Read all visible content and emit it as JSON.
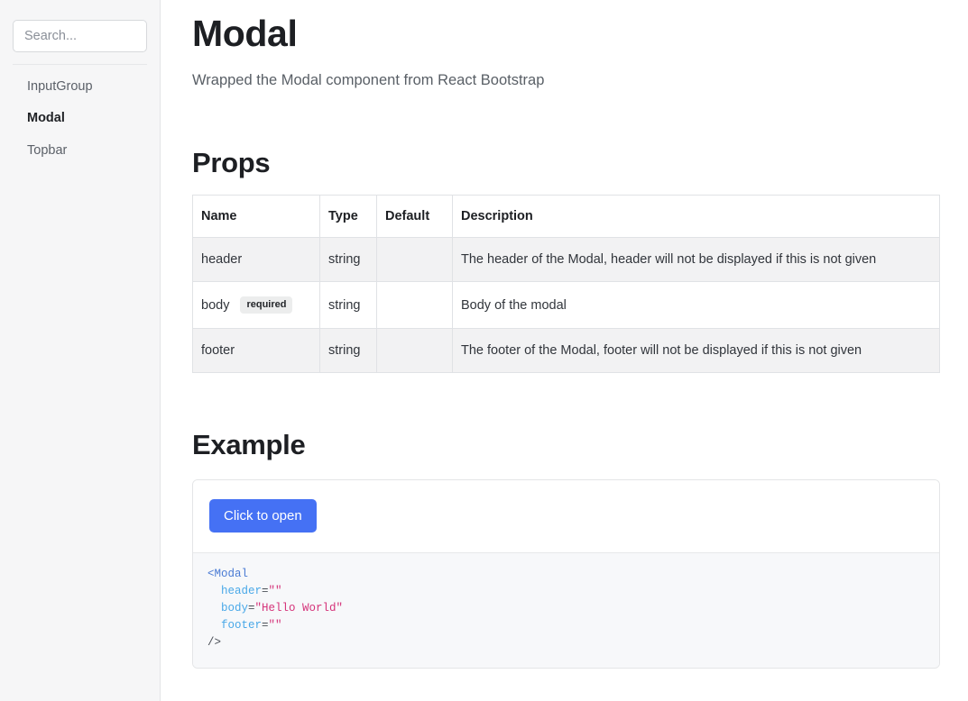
{
  "sidebar": {
    "search": {
      "placeholder": "Search...",
      "value": ""
    },
    "items": [
      {
        "label": "InputGroup",
        "active": false
      },
      {
        "label": "Modal",
        "active": true
      },
      {
        "label": "Topbar",
        "active": false
      }
    ]
  },
  "main": {
    "title": "Modal",
    "subtitle": "Wrapped the Modal component from React Bootstrap",
    "props_section": {
      "heading": "Props",
      "columns": [
        "Name",
        "Type",
        "Default",
        "Description"
      ],
      "rows": [
        {
          "name": "header",
          "required": false,
          "required_label": "",
          "type": "string",
          "default": "",
          "description": "The header of the Modal, header will not be displayed if this is not given"
        },
        {
          "name": "body",
          "required": true,
          "required_label": "required",
          "type": "string",
          "default": "",
          "description": "Body of the modal"
        },
        {
          "name": "footer",
          "required": false,
          "required_label": "",
          "type": "string",
          "default": "",
          "description": "The footer of the Modal, footer will not be displayed if this is not given"
        }
      ]
    },
    "example_section": {
      "heading": "Example",
      "button_label": "Click to open",
      "code": {
        "line1_tag": "<Modal",
        "line2_attr": "header",
        "line2_value": "\"\"",
        "line3_attr": "body",
        "line3_value": "\"Hello World\"",
        "line4_attr": "footer",
        "line4_value": "\"\"",
        "line5_close": "/>"
      }
    }
  },
  "colors": {
    "accent": "#4571f4",
    "sidebar_bg": "#f6f6f7",
    "table_stripe": "#f2f2f3",
    "code_bg": "#f7f8fa",
    "code_tag": "#4a7bd4",
    "code_attr": "#49a8e8",
    "code_string": "#d5347a"
  }
}
